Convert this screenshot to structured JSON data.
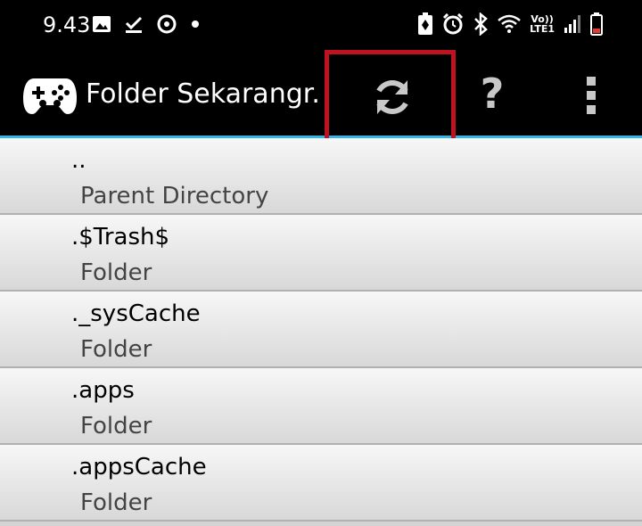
{
  "status_bar": {
    "time": "9.43",
    "left_icons": [
      "image-icon",
      "download-done-icon",
      "sync-icon",
      "dot-icon"
    ],
    "right_icons": [
      "battery-saver-icon",
      "alarm-icon",
      "bluetooth-icon",
      "wifi-calling-icon",
      "volte-icon",
      "signal-icon",
      "battery-icon"
    ],
    "network_label_top": "Vo))",
    "network_label_bottom": "LTE1"
  },
  "app_bar": {
    "title": "Folder Sekarangr...",
    "logo_icon": "gamepad-icon",
    "actions": [
      "refresh-icon",
      "help-icon",
      "overflow-menu-icon"
    ],
    "help_label": "?",
    "accent_color": "#35b5e5",
    "highlight_color": "#c1121f"
  },
  "files": [
    {
      "name": "..",
      "type": "Parent Directory"
    },
    {
      "name": ".$Trash$",
      "type": "Folder"
    },
    {
      "name": "._sysCache",
      "type": "Folder"
    },
    {
      "name": ".apps",
      "type": "Folder"
    },
    {
      "name": ".appsCache",
      "type": "Folder"
    }
  ]
}
